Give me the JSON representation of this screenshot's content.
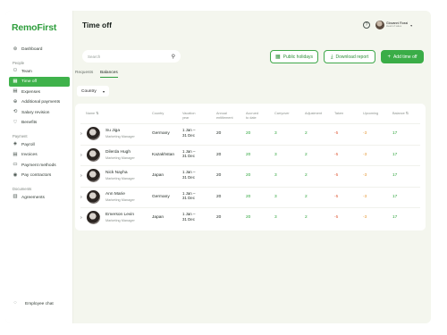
{
  "app": {
    "logo": "RemoFirst"
  },
  "sidebar": {
    "items_top": [
      {
        "label": "Dashboard",
        "icon": "dashboard-icon",
        "glyph": "⊚"
      }
    ],
    "people_label": "People",
    "people": [
      {
        "label": "Team",
        "icon": "team-icon",
        "glyph": "⚇",
        "active": false
      },
      {
        "label": "Time off",
        "icon": "calendar-icon",
        "glyph": "▦",
        "active": true
      },
      {
        "label": "Expenses",
        "icon": "expenses-icon",
        "glyph": "▤",
        "active": false
      },
      {
        "label": "Additional payments",
        "icon": "payments-icon",
        "glyph": "⊕",
        "active": false
      },
      {
        "label": "Salary revision",
        "icon": "salary-icon",
        "glyph": "⟲",
        "active": false
      },
      {
        "label": "Benefits",
        "icon": "benefits-icon",
        "glyph": "♡",
        "active": false
      }
    ],
    "payment_label": "Payment",
    "payment": [
      {
        "label": "Payroll",
        "icon": "payroll-icon",
        "glyph": "◈"
      },
      {
        "label": "Invoices",
        "icon": "invoices-icon",
        "glyph": "▤"
      },
      {
        "label": "Payment methods",
        "icon": "card-icon",
        "glyph": "▭"
      },
      {
        "label": "Pay contractors",
        "icon": "contractors-icon",
        "glyph": "◉"
      }
    ],
    "documents_label": "Documents",
    "documents": [
      {
        "label": "Agreements",
        "icon": "agreements-icon",
        "glyph": "▥"
      }
    ],
    "chat": {
      "label": "Employee chat",
      "glyph": "◌"
    }
  },
  "header": {
    "title": "Time off",
    "help_glyph": "?",
    "user": {
      "name": "Giovanni Rossi",
      "role": "Head of sales"
    }
  },
  "toolbar": {
    "search_placeholder": "Search",
    "public_holidays": "Public holidays",
    "download_report": "Download report",
    "add_time_off": "Add time off"
  },
  "tabs": [
    {
      "label": "Requests",
      "active": false
    },
    {
      "label": "Balances",
      "active": true
    }
  ],
  "filter": {
    "label": "Country"
  },
  "table": {
    "headers": [
      "Name",
      "Country",
      "Vacation year",
      "Annual entitlement",
      "Accrued to date",
      "Carryover",
      "Adjustment",
      "Taken",
      "Upcoming",
      "Balance"
    ],
    "header_lines": [
      [
        "Name ⇅"
      ],
      [
        "Country"
      ],
      [
        "Vacation",
        "year"
      ],
      [
        "Annual",
        "entitlement"
      ],
      [
        "Accrued",
        "to date"
      ],
      [
        "Carryover"
      ],
      [
        "Adjustment"
      ],
      [
        "Taken"
      ],
      [
        "Upcoming"
      ],
      [
        "Balance ⇅"
      ]
    ],
    "rows": [
      {
        "name": "Su Jiga",
        "role": "Marketing Manager",
        "country": "Germany",
        "year1": "1 Jan –",
        "year2": "31 Dec",
        "entitlement": "20",
        "accrued": "20",
        "carryover": "3",
        "adjustment": "2",
        "taken": "-5",
        "upcoming": "-3",
        "balance": "17"
      },
      {
        "name": "Dilerda Hugh",
        "role": "Marketing Manager",
        "country": "Kazakhstan",
        "year1": "1 Jan –",
        "year2": "31 Dec",
        "entitlement": "20",
        "accrued": "20",
        "carryover": "3",
        "adjustment": "2",
        "taken": "-5",
        "upcoming": "-3",
        "balance": "17"
      },
      {
        "name": "Nick Nayha",
        "role": "Marketing Manager",
        "country": "Japan",
        "year1": "1 Jan –",
        "year2": "31 Dec",
        "entitlement": "20",
        "accrued": "20",
        "carryover": "3",
        "adjustment": "2",
        "taken": "-5",
        "upcoming": "-3",
        "balance": "17"
      },
      {
        "name": "Ann Marie",
        "role": "Marketing Manager",
        "country": "Germany",
        "year1": "1 Jan –",
        "year2": "31 Dec",
        "entitlement": "20",
        "accrued": "20",
        "carryover": "3",
        "adjustment": "2",
        "taken": "-5",
        "upcoming": "-3",
        "balance": "17"
      },
      {
        "name": "Emerson Levin",
        "role": "Marketing Manager",
        "country": "Japan",
        "year1": "1 Jan –",
        "year2": "31 Dec",
        "entitlement": "20",
        "accrued": "20",
        "carryover": "3",
        "adjustment": "2",
        "taken": "-5",
        "upcoming": "-3",
        "balance": "17"
      }
    ]
  },
  "colors": {
    "accent": "#3aad47",
    "negative": "#e0603f",
    "upcoming": "#e69a3a",
    "background": "#f4f6ee"
  }
}
